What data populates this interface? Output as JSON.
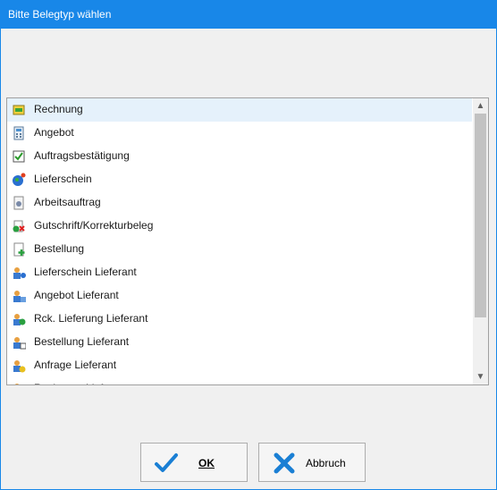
{
  "window": {
    "title": "Bitte Belegtyp wählen"
  },
  "list": {
    "items": [
      {
        "label": "Rechnung",
        "icon": "invoice-icon",
        "selected": true
      },
      {
        "label": "Angebot",
        "icon": "calculator-icon"
      },
      {
        "label": "Auftragsbestätigung",
        "icon": "checkbox-icon"
      },
      {
        "label": "Lieferschein",
        "icon": "globe-icon"
      },
      {
        "label": "Arbeitsauftrag",
        "icon": "gear-document-icon"
      },
      {
        "label": "Gutschrift/Korrekturbeleg",
        "icon": "credit-note-icon"
      },
      {
        "label": "Bestellung",
        "icon": "document-add-icon"
      },
      {
        "label": "Lieferschein Lieferant",
        "icon": "supplier-delivery-icon"
      },
      {
        "label": "Angebot Lieferant",
        "icon": "supplier-quote-icon"
      },
      {
        "label": "Rck. Lieferung Lieferant",
        "icon": "supplier-return-icon"
      },
      {
        "label": "Bestellung Lieferant",
        "icon": "supplier-order-icon"
      },
      {
        "label": "Anfrage Lieferant",
        "icon": "supplier-inquiry-icon"
      },
      {
        "label": "Rechnung Lieferant",
        "icon": "supplier-invoice-icon"
      }
    ]
  },
  "buttons": {
    "ok": "OK",
    "cancel": "Abbruch"
  },
  "colors": {
    "titlebar": "#1887e8",
    "selection": "#e5f1fb",
    "ok_check": "#1a7fd4",
    "cancel_x": "#1a7fd4"
  }
}
